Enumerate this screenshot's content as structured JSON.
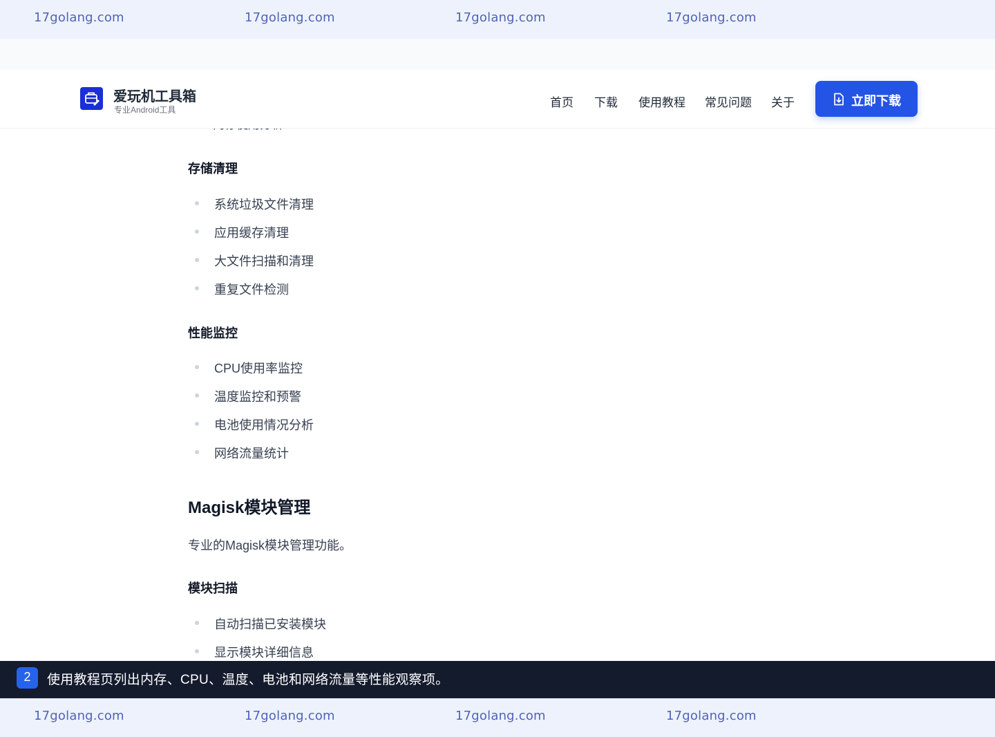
{
  "watermark": [
    "17golang.com",
    "17golang.com",
    "17golang.com",
    "17golang.com"
  ],
  "brand": {
    "title": "爱玩机工具箱",
    "subtitle": "专业Android工具"
  },
  "nav": [
    "首页",
    "下载",
    "使用教程",
    "常见问题",
    "关于"
  ],
  "cta": {
    "label": "立即下载",
    "icon": "download-file-icon"
  },
  "content": {
    "cut_off_text": "内存使用分析",
    "sections": [
      {
        "heading": "存储清理",
        "items": [
          "系统垃圾文件清理",
          "应用缓存清理",
          "大文件扫描和清理",
          "重复文件检测"
        ]
      },
      {
        "heading": "性能监控",
        "items": [
          "CPU使用率监控",
          "温度监控和预警",
          "电池使用情况分析",
          "网络流量统计"
        ]
      }
    ],
    "magisk": {
      "title": "Magisk模块管理",
      "desc": "专业的Magisk模块管理功能。",
      "subheading": "模块扫描",
      "items": [
        "自动扫描已安装模块",
        "显示模块详细信息"
      ]
    }
  },
  "caption": {
    "step": "2",
    "text": "使用教程页列出内存、CPU、温度、电池和网络流量等性能观察项。"
  },
  "colors": {
    "accent": "#2354e6",
    "logo": "#1a2fd6",
    "caption_bg": "#141b2d",
    "watermark_bg": "#eef2fc"
  }
}
